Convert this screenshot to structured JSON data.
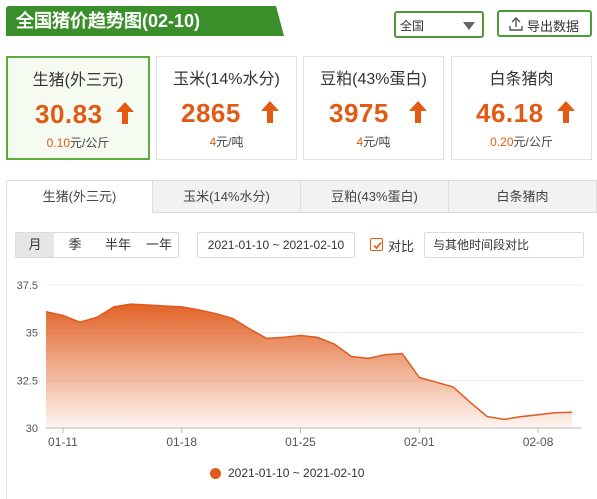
{
  "header": {
    "title": "全国猪价趋势图(02-10)",
    "region_selected": "全国",
    "export_label": "导出数据"
  },
  "cards": [
    {
      "name": "生猪(外三元)",
      "price": "30.83",
      "change_value": "0.10",
      "change_unit": "元/公斤",
      "active": true
    },
    {
      "name": "玉米(14%水分)",
      "price": "2865",
      "change_value": "4",
      "change_unit": "元/吨",
      "active": false
    },
    {
      "name": "豆粕(43%蛋白)",
      "price": "3975",
      "change_value": "4",
      "change_unit": "元/吨",
      "active": false
    },
    {
      "name": "白条猪肉",
      "price": "46.18",
      "change_value": "0.20",
      "change_unit": "元/公斤",
      "active": false
    }
  ],
  "tabs": [
    "生猪(外三元)",
    "玉米(14%水分)",
    "豆粕(43%蛋白)",
    "白条猪肉"
  ],
  "periods": [
    "月",
    "季",
    "半年",
    "一年"
  ],
  "date_range": "2021-01-10 ~ 2021-02-10",
  "compare": {
    "label": "对比",
    "checked": true,
    "placeholder": "与其他时间段对比"
  },
  "colors": {
    "accent": "#e35a14",
    "brand_green": "#3a8f2a",
    "series": "#e05a1c"
  },
  "icons": {
    "up": "up-arrow-icon",
    "export": "upload-icon",
    "dropdown": "triangle-down-icon",
    "check": "check-icon"
  },
  "chart_data": {
    "type": "area",
    "x": [
      "2021-01-10",
      "2021-01-11",
      "2021-01-12",
      "2021-01-13",
      "2021-01-14",
      "2021-01-15",
      "2021-01-16",
      "2021-01-17",
      "2021-01-18",
      "2021-01-19",
      "2021-01-20",
      "2021-01-21",
      "2021-01-22",
      "2021-01-23",
      "2021-01-24",
      "2021-01-25",
      "2021-01-26",
      "2021-01-27",
      "2021-01-28",
      "2021-01-29",
      "2021-01-30",
      "2021-01-31",
      "2021-02-01",
      "2021-02-02",
      "2021-02-03",
      "2021-02-04",
      "2021-02-05",
      "2021-02-06",
      "2021-02-07",
      "2021-02-08",
      "2021-02-09",
      "2021-02-10"
    ],
    "series": [
      {
        "name": "2021-01-10 ~ 2021-02-10",
        "values": [
          36.1,
          35.9,
          35.55,
          35.8,
          36.35,
          36.5,
          36.45,
          36.4,
          36.35,
          36.2,
          36.0,
          35.75,
          35.2,
          34.7,
          34.75,
          34.85,
          34.75,
          34.4,
          33.75,
          33.65,
          33.85,
          33.9,
          32.65,
          32.4,
          32.15,
          31.35,
          30.6,
          30.45,
          30.6,
          30.7,
          30.8,
          30.83
        ]
      }
    ],
    "ylim": [
      30,
      37.5
    ],
    "yticks": [
      "30",
      "32.5",
      "35",
      "37.5"
    ],
    "ytick_values": [
      30,
      32.5,
      35,
      37.5
    ],
    "xticks": [
      {
        "date": "2021-01-11",
        "label": "01-11"
      },
      {
        "date": "2021-01-18",
        "label": "01-18"
      },
      {
        "date": "2021-01-25",
        "label": "01-25"
      },
      {
        "date": "2021-02-01",
        "label": "02-01"
      },
      {
        "date": "2021-02-08",
        "label": "02-08"
      }
    ],
    "grid": "horizontal",
    "legend": "bottom"
  }
}
